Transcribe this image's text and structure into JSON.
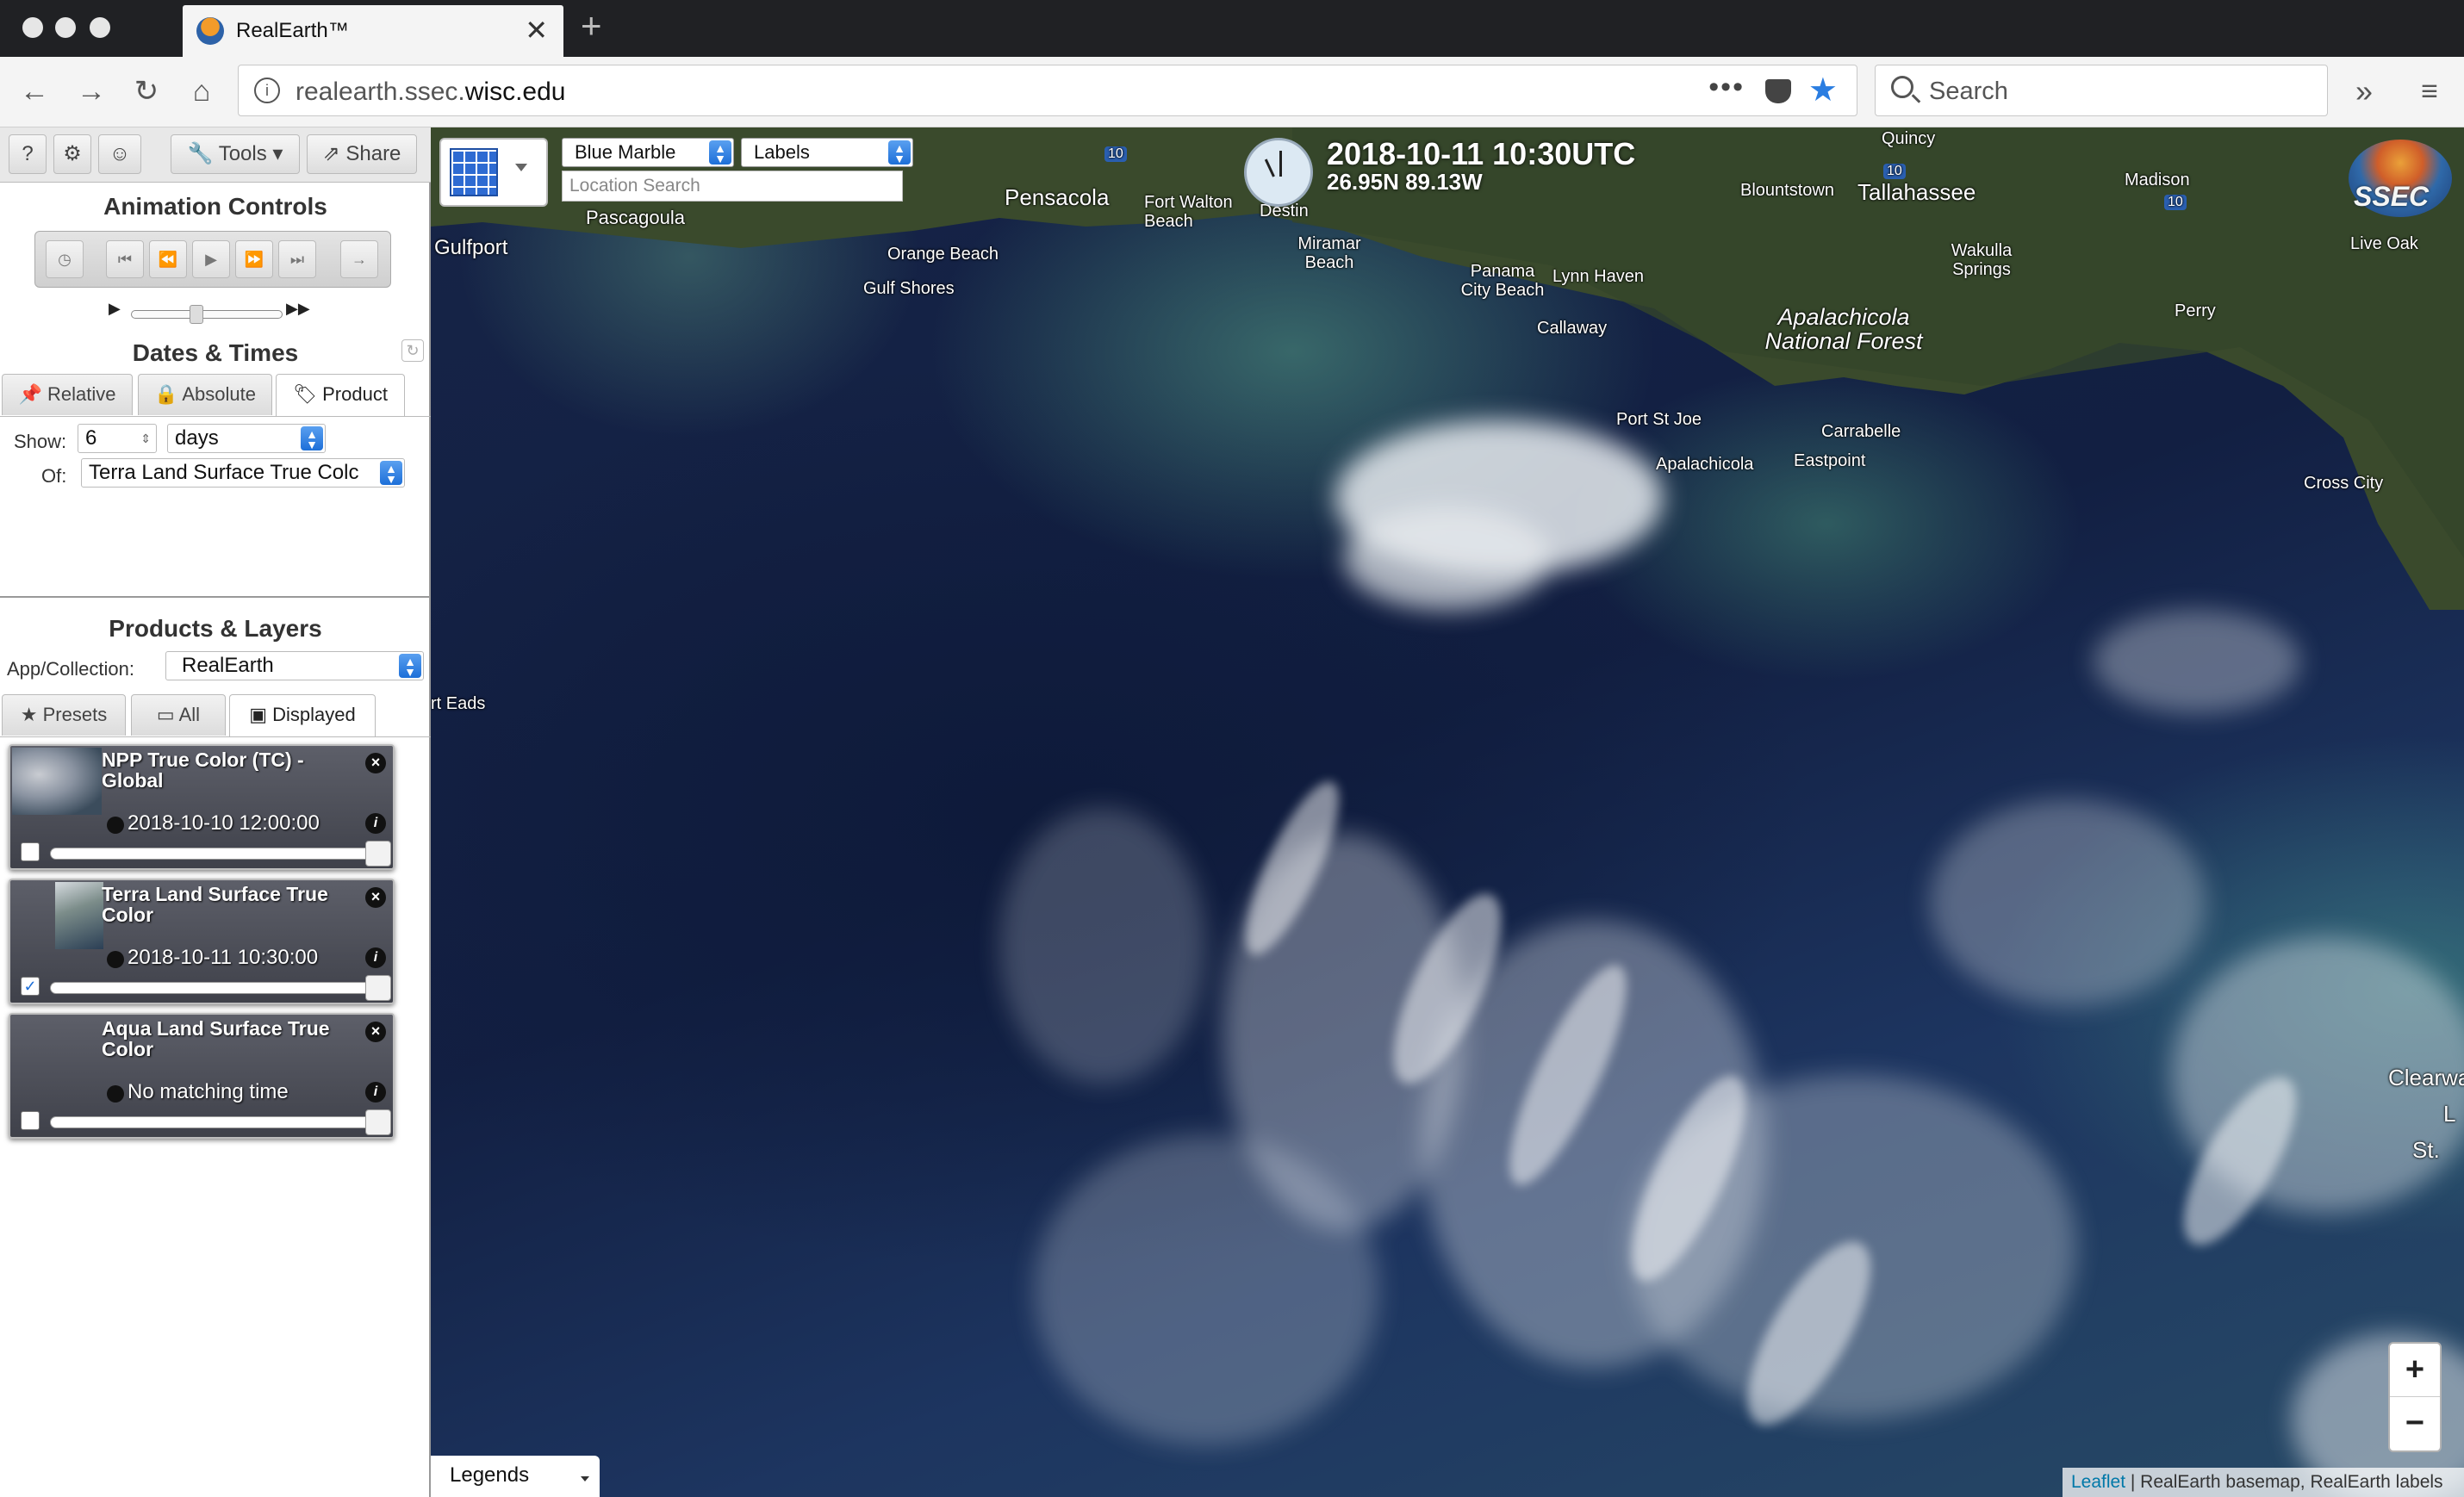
{
  "browser": {
    "tab_title": "RealEarth™",
    "url_host_prefix": "realearth.ssec.",
    "url_host_domain": "wisc.edu",
    "search_placeholder": "Search"
  },
  "sidebar": {
    "toolbar": {
      "help": "?",
      "tools": "Tools",
      "share": "Share"
    },
    "animation": {
      "title": "Animation Controls"
    },
    "dates": {
      "title": "Dates & Times",
      "tabs": [
        "Relative",
        "Absolute",
        "Product"
      ],
      "active_tab": "Product",
      "show_label": "Show:",
      "show_value": "6",
      "unit_value": "days",
      "of_label": "Of:",
      "of_value": "Terra Land Surface True Colc"
    },
    "products": {
      "title": "Products & Layers",
      "collection_label": "App/Collection:",
      "collection_value": "RealEarth",
      "tabs": [
        "Presets",
        "All",
        "Displayed"
      ],
      "active_tab": "Displayed",
      "layers": [
        {
          "name": "NPP True Color (TC) - Global",
          "time": "2018-10-10 12:00:00",
          "checked": false
        },
        {
          "name": "Terra Land Surface True Color",
          "time": "2018-10-11 10:30:00",
          "checked": true
        },
        {
          "name": "Aqua Land Surface True Color",
          "time": "No matching time",
          "checked": false
        }
      ]
    }
  },
  "map": {
    "basemap_select": "Blue Marble",
    "labels_select": "Labels",
    "location_placeholder": "Location Search",
    "datetime": "2018-10-11 10:30UTC",
    "coords": "26.95N 89.13W",
    "logo_text": "SSEC",
    "legends_label": "Legends",
    "zoom_in": "+",
    "zoom_out": "−",
    "attribution_link": "Leaflet",
    "attribution_text": " | RealEarth basemap, RealEarth labels",
    "place_labels": {
      "gulfport": "Gulfport",
      "pascagoula": "Pascagoula",
      "pensacola": "Pensacola",
      "fort_walton": "Fort Walton Beach",
      "destin": "Destin",
      "orange_beach": "Orange Beach",
      "gulf_shores": "Gulf Shores",
      "miramar": "Miramar Beach",
      "panama_city": "Panama City Beach",
      "lynn_haven": "Lynn Haven",
      "callaway": "Callaway",
      "blountstown": "Blountstown",
      "tallahassee": "Tallahassee",
      "quincy": "Quincy",
      "madison": "Madison",
      "live_oak": "Live Oak",
      "wakulla": "Wakulla Springs",
      "apalachicola_nf": "Apalachicola National Forest",
      "perry": "Perry",
      "port_st_joe": "Port St Joe",
      "apalachicola": "Apalachicola",
      "carrabelle": "Carrabelle",
      "eastpoint": "Eastpoint",
      "cross_city": "Cross City",
      "eads": "rt Eads",
      "clearwater": "Clearwa",
      "st": "St.",
      "l": "L",
      "i10a": "10",
      "i10b": "10",
      "i10c": "10"
    }
  }
}
